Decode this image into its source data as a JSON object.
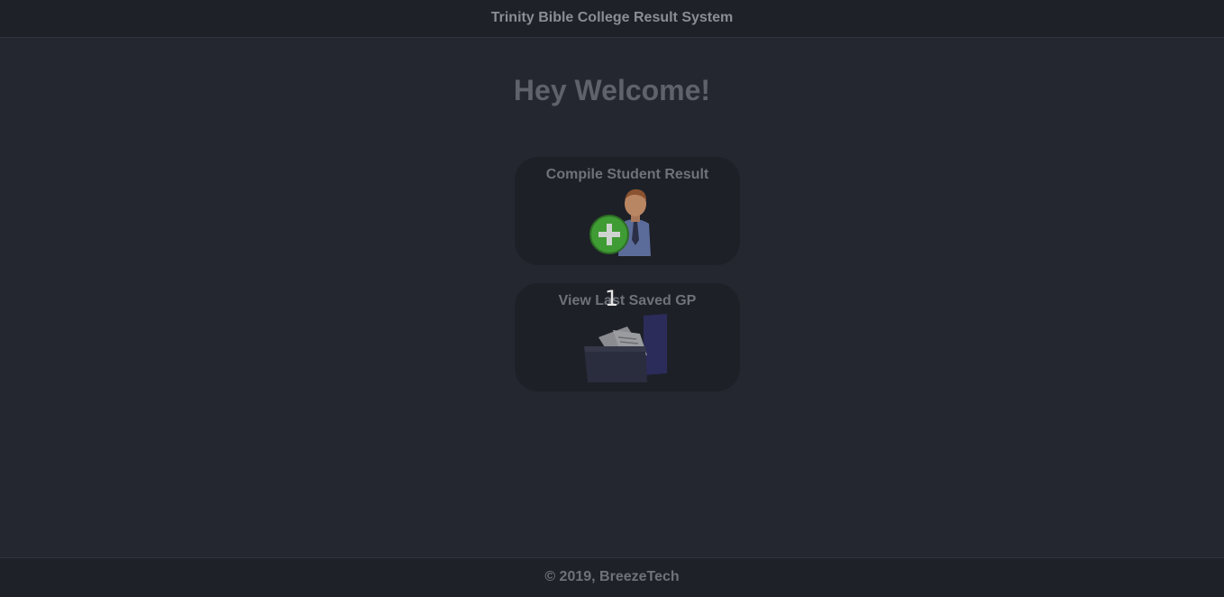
{
  "header": {
    "title": "Trinity Bible College Result System"
  },
  "main": {
    "heading": "Hey Welcome!",
    "cards": [
      {
        "label": "Compile Student Result",
        "icon": "add-student-icon"
      },
      {
        "label": "View Last Saved GP",
        "icon": "folder-documents-icon"
      }
    ],
    "cursor_text": "1"
  },
  "footer": {
    "copyright": "© 2019, BreezeTech"
  },
  "colors": {
    "background": "#242730",
    "bar": "#1e2128",
    "card": "#1d2027",
    "text_muted": "#6f727a",
    "accent_green": "#4caf3a"
  }
}
